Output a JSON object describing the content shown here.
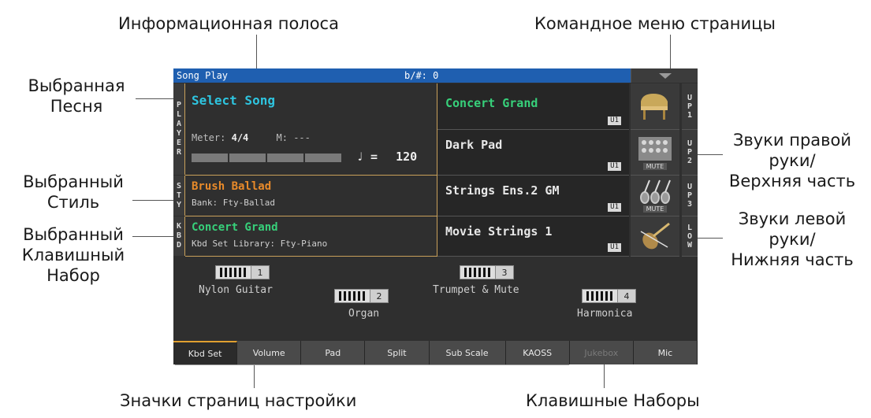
{
  "callouts": {
    "info_bar": "Информационная полоса",
    "page_menu": "Командное меню страницы",
    "selected_song": [
      "Выбранная",
      "Песня"
    ],
    "selected_style": [
      "Выбранный",
      "Стиль"
    ],
    "selected_kbd_set": [
      "Выбранный",
      "Клавишный",
      "Набор"
    ],
    "right_hand_sounds": [
      "Звуки правой",
      "руки/",
      "Верхняя часть"
    ],
    "left_hand_sounds": [
      "Звуки левой",
      "руки/",
      "Нижняя часть"
    ],
    "setting_pages": "Значки страниц настройки",
    "keyboard_sets": "Клавишные Наборы"
  },
  "screen": {
    "title": "Song Play",
    "key_indicator": "b/#: 0",
    "side_labels": {
      "player": "PLAYER",
      "style": "STY",
      "kbd": "KBD"
    },
    "song": {
      "name": "Select Song",
      "meter_label": "Meter:",
      "meter_value": "4/4",
      "measure_label": "M:",
      "measure_value": "---",
      "tempo_symbol": "♩ =",
      "tempo": "120"
    },
    "style": {
      "name": "Brush Ballad",
      "bank": "Bank: Fty-Ballad"
    },
    "kbd_set": {
      "name": "Concert Grand",
      "library": "Kbd Set Library: Fty-Piano"
    },
    "sounds": [
      {
        "name": "Concert Grand",
        "chip": "U1",
        "part": "UP1",
        "icon": "grand-piano-icon",
        "mute": ""
      },
      {
        "name": "Dark Pad",
        "chip": "U1",
        "part": "UP2",
        "icon": "synth-pad-icon",
        "mute": "MUTE"
      },
      {
        "name": "Strings Ens.2 GM",
        "chip": "U1",
        "part": "UP3",
        "icon": "violins-icon",
        "mute": "MUTE"
      },
      {
        "name": "Movie Strings 1",
        "chip": "U1",
        "part": "LOW",
        "icon": "cello-icon",
        "mute": ""
      }
    ],
    "kbd_sets": [
      {
        "num": "1",
        "name": "Nylon Guitar"
      },
      {
        "num": "2",
        "name": "Organ"
      },
      {
        "num": "3",
        "name": "Trumpet & Mute"
      },
      {
        "num": "4",
        "name": "Harmonica"
      }
    ],
    "tabs": [
      {
        "label": "Kbd Set",
        "state": "active"
      },
      {
        "label": "Volume",
        "state": ""
      },
      {
        "label": "Pad",
        "state": ""
      },
      {
        "label": "Split",
        "state": ""
      },
      {
        "label": "Sub Scale",
        "state": ""
      },
      {
        "label": "KAOSS",
        "state": ""
      },
      {
        "label": "Jukebox",
        "state": "disabled"
      },
      {
        "label": "Mic",
        "state": ""
      }
    ],
    "colors": {
      "infobar": "#1f5fb0",
      "song_name": "#2ec5e0",
      "style_name": "#e88a2a",
      "kbd_name": "#37d07a",
      "sound1_name": "#37d07a",
      "divider": "#c9a05a",
      "tab_active_marker": "#e0a030"
    }
  }
}
